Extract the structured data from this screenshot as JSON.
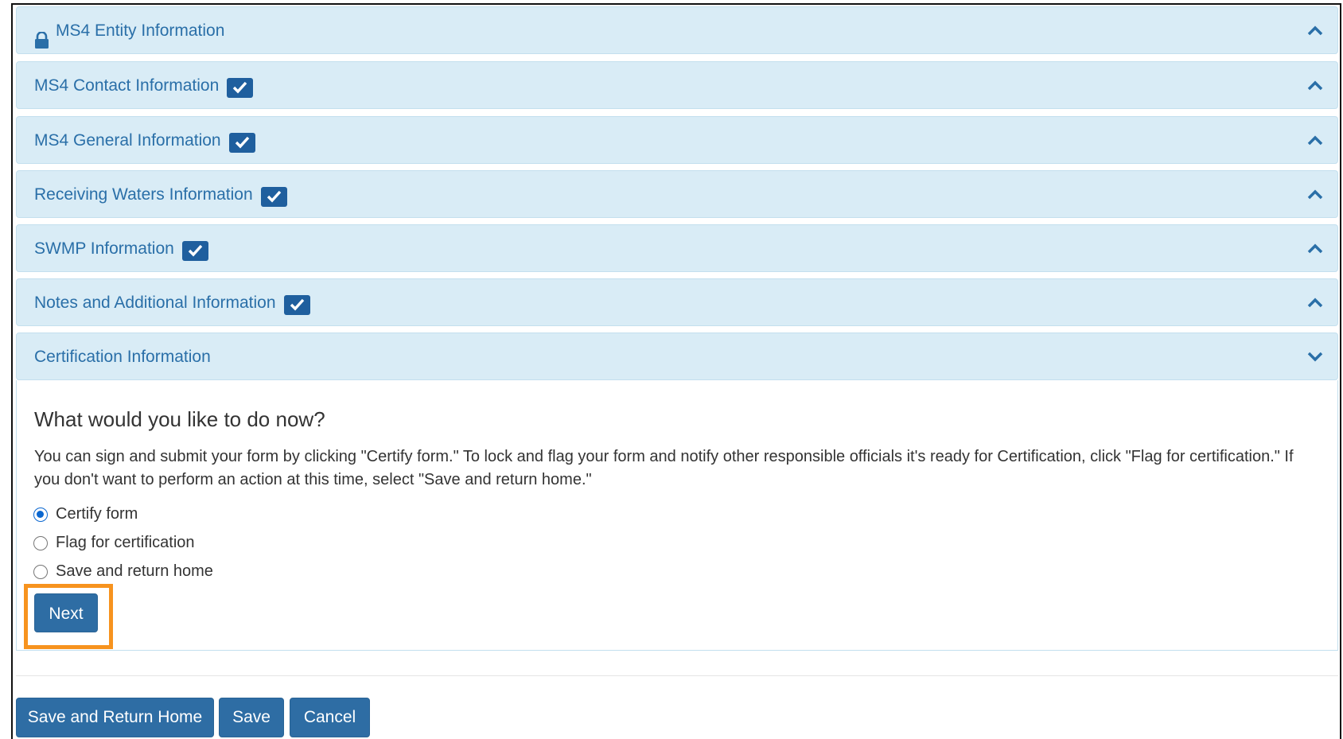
{
  "panels": [
    {
      "label": "MS4 Entity Information",
      "icon": "lock-icon",
      "checked": false,
      "chevron": "up"
    },
    {
      "label": "MS4 Contact Information",
      "icon": "",
      "checked": true,
      "chevron": "up"
    },
    {
      "label": "MS4 General Information",
      "icon": "",
      "checked": true,
      "chevron": "up"
    },
    {
      "label": "Receiving Waters Information",
      "icon": "",
      "checked": true,
      "chevron": "up"
    },
    {
      "label": "SWMP Information",
      "icon": "",
      "checked": true,
      "chevron": "up"
    },
    {
      "label": "Notes and Additional Information",
      "icon": "",
      "checked": true,
      "chevron": "up"
    },
    {
      "label": "Certification Information",
      "icon": "",
      "checked": false,
      "chevron": "down"
    }
  ],
  "certification": {
    "question": "What would you like to do now?",
    "intro": "You can sign and submit your form by clicking \"Certify form.\" To lock and flag your form and notify other responsible officials it's ready for Certification, click \"Flag for certification.\" If you don't want to perform an action at this time, select \"Save and return home.\"",
    "options": [
      {
        "label": "Certify form",
        "selected": true
      },
      {
        "label": "Flag for certification",
        "selected": false
      },
      {
        "label": "Save and return home",
        "selected": false
      }
    ],
    "next_label": "Next"
  },
  "footer": {
    "save_return_label": "Save and Return Home",
    "save_label": "Save",
    "cancel_label": "Cancel"
  },
  "colors": {
    "panel_bg": "#d9ecf6",
    "link_blue": "#2a6fa8",
    "button_blue": "#2e6da4",
    "highlight_orange": "#f7931e"
  }
}
